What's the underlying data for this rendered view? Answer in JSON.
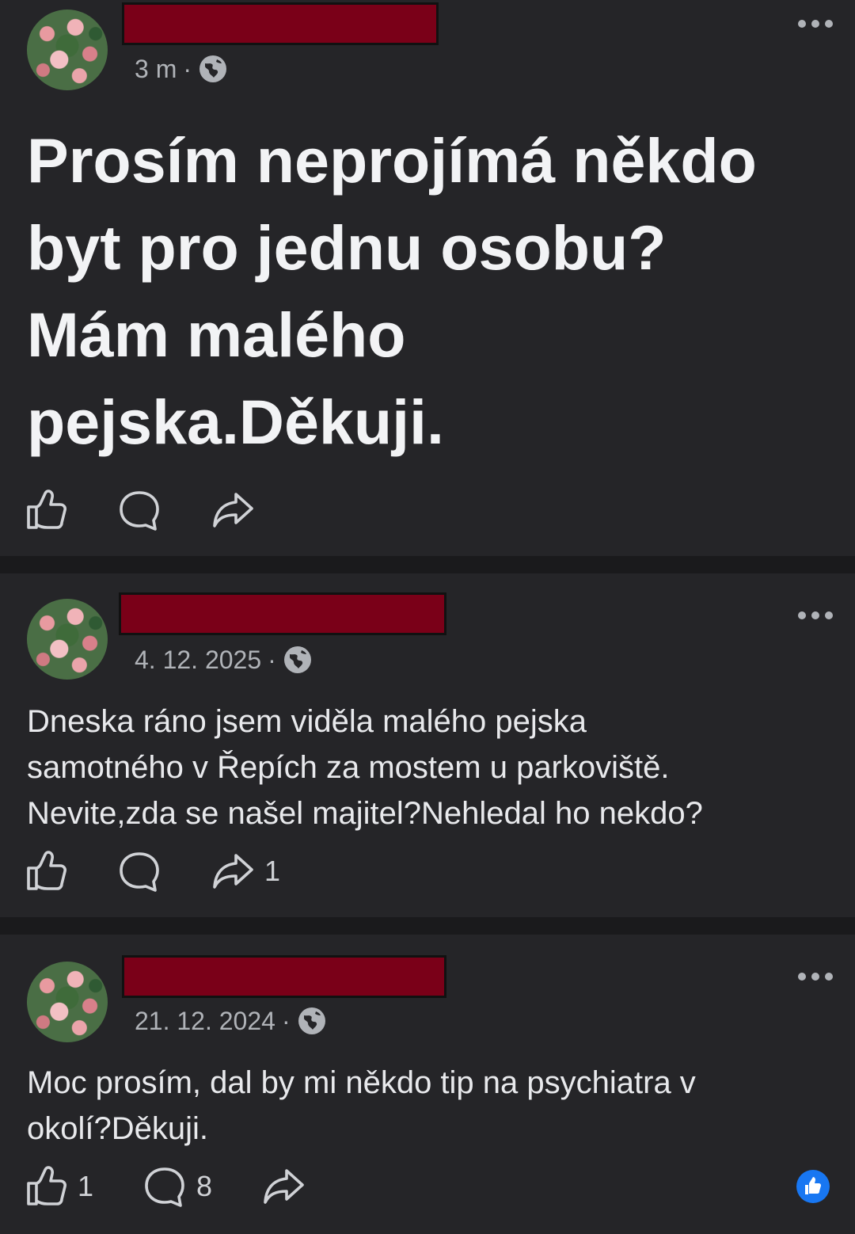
{
  "posts": [
    {
      "time": "3 m",
      "separator": "·",
      "text_line1": "Prosím neprojímá někdo",
      "text_line2": "byt pro jednu osobu?",
      "text_line3": "Mám malého",
      "text_line4": "pejska.Děkuji.",
      "likes": "",
      "comments": "",
      "shares": ""
    },
    {
      "time": "4. 12. 2025",
      "separator": "·",
      "text_line1": "Dneska ráno jsem viděla malého pejska",
      "text_line2": "samotného v Řepích za mostem u parkoviště.",
      "text_line3": "Nevite,zda se našel majitel?Nehledal ho nekdo?",
      "likes": "",
      "comments": "",
      "shares": "1"
    },
    {
      "time": "21. 12. 2024",
      "separator": "·",
      "text_line1": "Moc prosím, dal by mi někdo tip na psychiatra v",
      "text_line2": "okolí?Děkuji.",
      "likes": "1",
      "comments": "8",
      "shares": ""
    }
  ],
  "icons": {
    "like": "thumbs-up-icon",
    "comment": "comment-icon",
    "share": "share-icon",
    "privacy": "globe-icon",
    "more": "more-options-icon",
    "reaction": "like-reaction-badge-icon"
  },
  "colors": {
    "background": "#1a1a1c",
    "card": "#252528",
    "redaction": "#7a0018",
    "reaction_blue": "#1877f2"
  }
}
